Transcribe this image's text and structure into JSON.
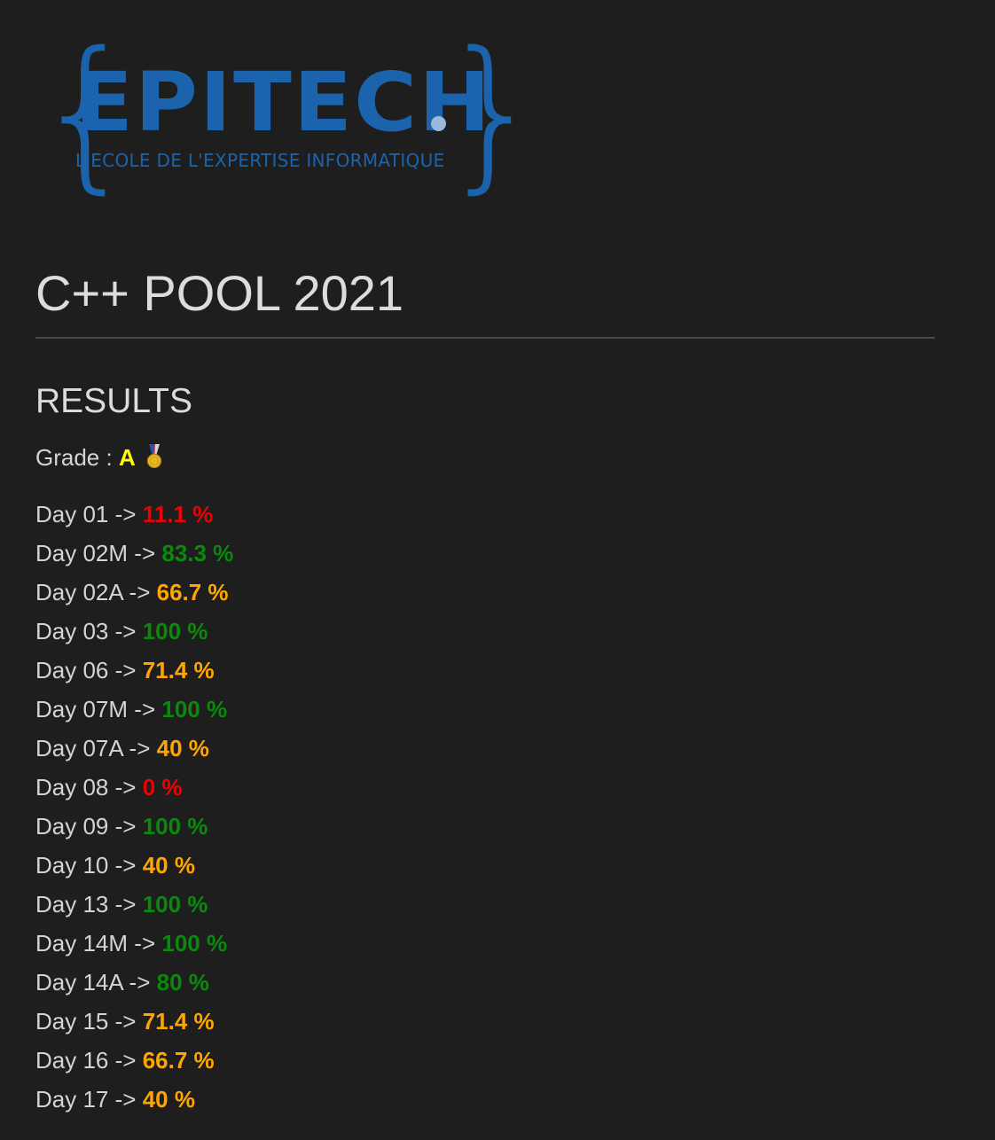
{
  "logo": {
    "brace_left": "{",
    "brace_right": "}",
    "wordmark": "EPITECH",
    "tagline": "L'ECOLE DE L'EXPERTISE INFORMATIQUE",
    "color": "#1c63ad",
    "dot_color": "#9eb8dc"
  },
  "title": "C++ POOL 2021",
  "section": "RESULTS",
  "grade": {
    "label": "Grade :",
    "value": "A",
    "icon": "medal-icon"
  },
  "separator": "->",
  "days": [
    {
      "day": "Day 01",
      "score": "11.1 %",
      "status": "red"
    },
    {
      "day": "Day 02M",
      "score": "83.3 %",
      "status": "green"
    },
    {
      "day": "Day 02A",
      "score": "66.7 %",
      "status": "orange"
    },
    {
      "day": "Day 03",
      "score": "100 %",
      "status": "green"
    },
    {
      "day": "Day 06",
      "score": "71.4 %",
      "status": "orange"
    },
    {
      "day": "Day 07M",
      "score": "100 %",
      "status": "green"
    },
    {
      "day": "Day 07A",
      "score": "40 %",
      "status": "orange"
    },
    {
      "day": "Day 08",
      "score": "0 %",
      "status": "red"
    },
    {
      "day": "Day 09",
      "score": "100 %",
      "status": "green"
    },
    {
      "day": "Day 10",
      "score": "40 %",
      "status": "orange"
    },
    {
      "day": "Day 13",
      "score": "100 %",
      "status": "green"
    },
    {
      "day": "Day 14M",
      "score": "100 %",
      "status": "green"
    },
    {
      "day": "Day 14A",
      "score": "80 %",
      "status": "green"
    },
    {
      "day": "Day 15",
      "score": "71.4 %",
      "status": "orange"
    },
    {
      "day": "Day 16",
      "score": "66.7 %",
      "status": "orange"
    },
    {
      "day": "Day 17",
      "score": "40 %",
      "status": "orange"
    }
  ],
  "colors": {
    "background": "#1e1e1e",
    "text": "#d4d4d4",
    "grade": "#ffff00",
    "red": "#ee0000",
    "green": "#0a8a0a",
    "orange": "#ffa500"
  }
}
